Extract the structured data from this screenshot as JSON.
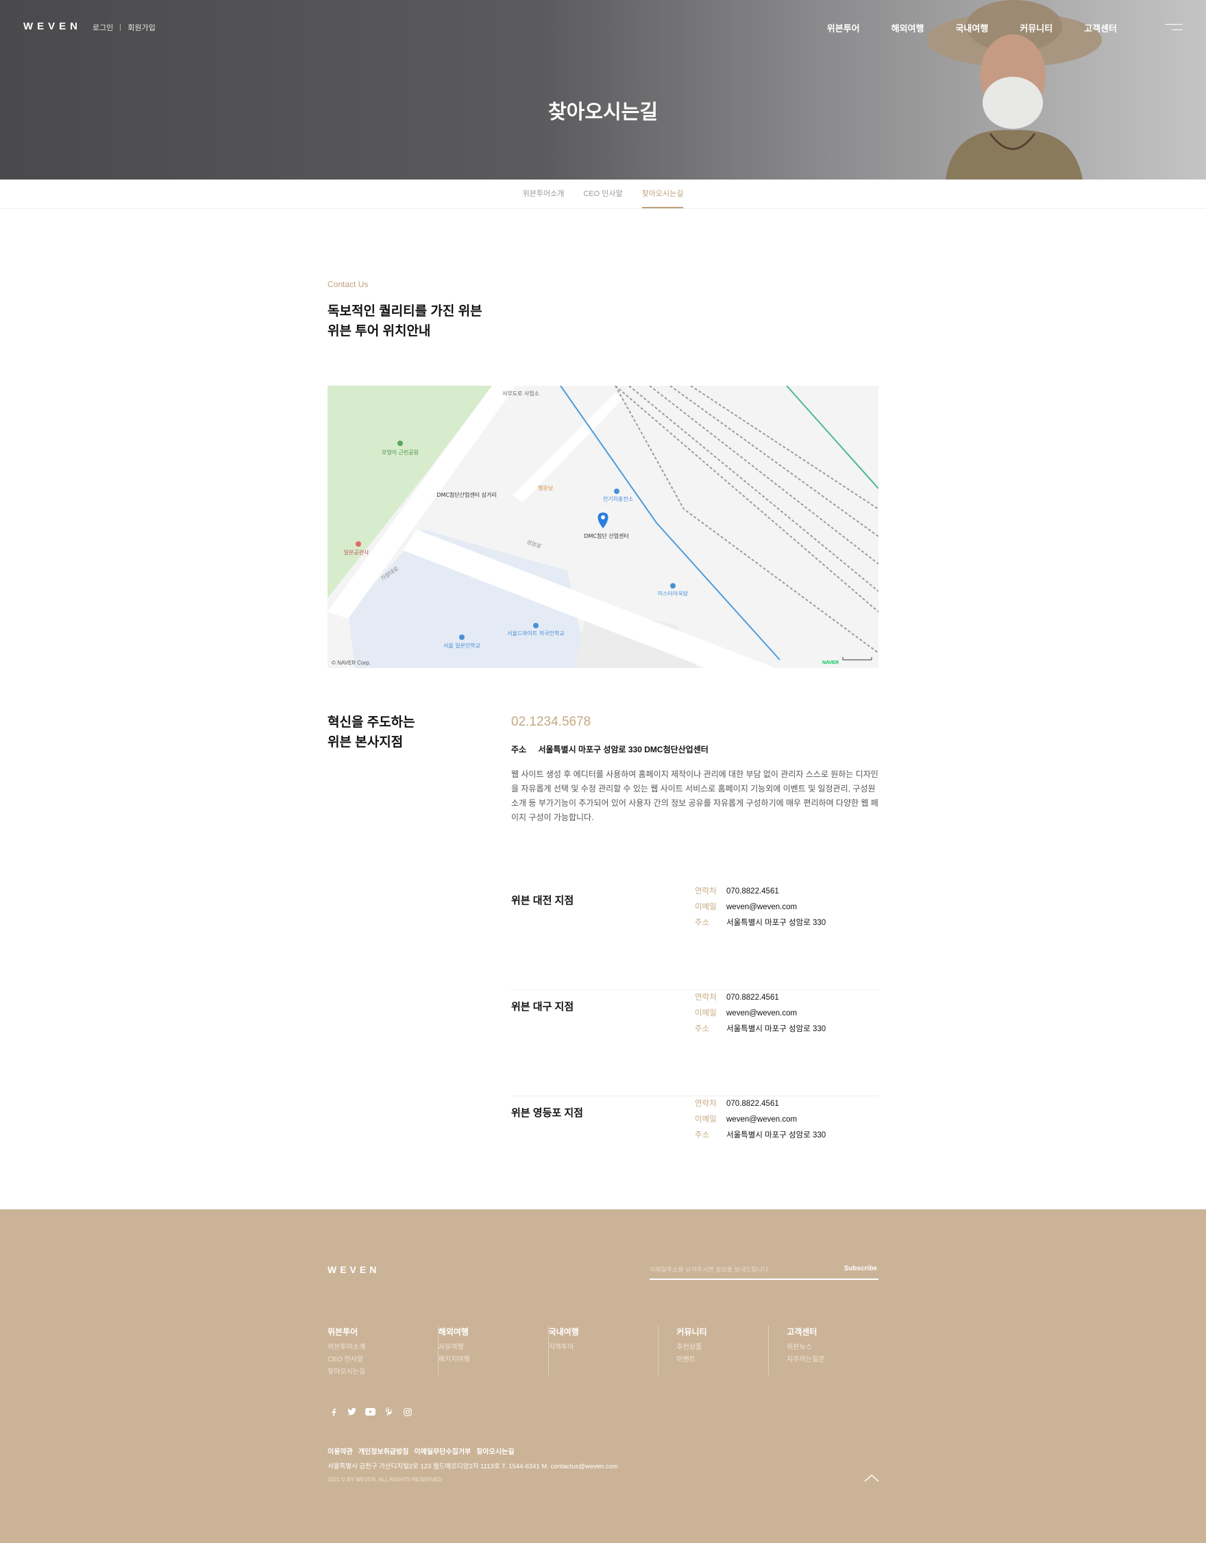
{
  "header": {
    "logo": "WEVEN",
    "auth": {
      "login": "로그인",
      "signup": "회원가입"
    },
    "nav": [
      "위븐투어",
      "해외여행",
      "국내여행",
      "커뮤니티",
      "고객센터"
    ],
    "page_title": "찾아오시는길"
  },
  "subnav": {
    "items": [
      "위븐투어소개",
      "CEO 인사말",
      "찾아오시는길"
    ],
    "active_index": 2
  },
  "contact": {
    "eyebrow": "Contact Us",
    "title_line1": "독보적인 퀄리티를 가진 위븐",
    "title_line2": "위븐 투어 위치안내"
  },
  "map": {
    "labels": {
      "park": "부엉이 근린공원",
      "crossroad": "DMC첨단산업센터 삼거리",
      "target": "DMC첨단 산업센터",
      "charge": "전기차충전소",
      "cafe": "행운남",
      "office": "서부도로 사업소",
      "road1": "가양대로",
      "road2": "성암로",
      "police": "일본공관사",
      "school1": "서울 일본인학교",
      "school2": "서울드와이트 외국인학교",
      "restaurant": "미스터아욱탕"
    },
    "copyright": "© NAVER Corp.",
    "brand": "NAVER"
  },
  "hq": {
    "title_line1": "혁신을 주도하는",
    "title_line2": "위븐 본사지점",
    "phone": "02.1234.5678",
    "address_label": "주소",
    "address": "서울특별시 마포구 성암로 330 DMC첨단산업센터",
    "description": "웹 사이트 생성 후 에디터를 사용하여 홈페이지 제작이나 관리에 대한 부담 없이 관리자 스스로 원하는 디자인을 자유롭게 선택 및 수정 관리할 수 있는 웹 사이트 서비스로 홈페이지 기능외에 이벤트 및 일정관리, 구성원소개 등 부가기능이 추가되어 있어 사용자 간의 정보 공유를 자유롭게 구성하기에 매우 편리하며 다양한 웹 페이지 구성이 가능합니다."
  },
  "branches": [
    {
      "name": "위븐 대전 지점",
      "tel_label": "연락처",
      "tel": "070.8822.4561",
      "email_label": "이메일",
      "email": "weven@weven.com",
      "addr_label": "주소",
      "addr": "서울특별시 마포구 성암로 330"
    },
    {
      "name": "위븐 대구 지점",
      "tel_label": "연락처",
      "tel": "070.8822.4561",
      "email_label": "이메일",
      "email": "weven@weven.com",
      "addr_label": "주소",
      "addr": "서울특별시 마포구 성암로 330"
    },
    {
      "name": "위븐 영등포 지점",
      "tel_label": "연락처",
      "tel": "070.8822.4561",
      "email_label": "이메일",
      "email": "weven@weven.com",
      "addr_label": "주소",
      "addr": "서울특별시 마포구 성암로 330"
    }
  ],
  "footer": {
    "logo": "WEVEN",
    "subscribe_placeholder": "이메일주소를 남겨주시면 정보를 보내드립니다",
    "subscribe_button": "Subscribe",
    "columns": [
      {
        "title": "위븐투어",
        "links": [
          "위븐투어소개",
          "CEO 인사말",
          "찾아오시는길"
        ]
      },
      {
        "title": "해외여행",
        "links": [
          "자유여행",
          "패키지여행"
        ]
      },
      {
        "title": "국내여행",
        "links": [
          "지역투어"
        ]
      },
      {
        "title": "커뮤니티",
        "links": [
          "추천상품",
          "이벤트"
        ]
      },
      {
        "title": "고객센터",
        "links": [
          "위븐뉴스",
          "자주하는질문"
        ]
      }
    ],
    "social_icons": [
      "facebook-icon",
      "twitter-icon",
      "youtube-icon",
      "pinterest-icon",
      "instagram-icon"
    ],
    "policies": [
      "이용약관",
      "개인정보취급방침",
      "이메일무단수집거부",
      "찾아오시는길"
    ],
    "company_info": "서울특별시 금천구 가산디지털2로 123 월드메르디앙2차 1113호   T. 1544-6341   M. contactus@weven.com",
    "copyright": "2021 © BY WEVEN. ALL RIGHTS RESERVED"
  },
  "colors": {
    "accent": "#c6a982",
    "footer_bg": "#cbb397",
    "hero_bg": "#5b5b5d"
  }
}
